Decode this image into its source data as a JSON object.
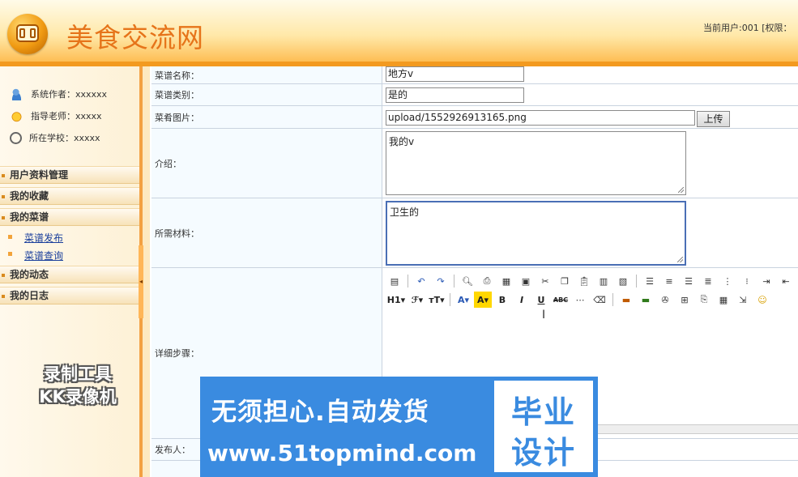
{
  "header": {
    "site_title": "美食交流网",
    "user_info": "当前用户:001 [权限："
  },
  "sidebar": {
    "info": [
      {
        "label": "系统作者：xxxxxx",
        "icon": "user-icon"
      },
      {
        "label": "指导老师：xxxxx",
        "icon": "teacher-icon"
      },
      {
        "label": "所在学校：xxxxx",
        "icon": "school-icon"
      }
    ],
    "menus": {
      "profile": "用户资料管理",
      "favorites": "我的收藏",
      "recipes": "我的菜谱",
      "recipe_publish": "菜谱发布",
      "recipe_query": "菜谱查询",
      "activity": "我的动态",
      "diary": "我的日志"
    },
    "watermark_line1": "录制工具",
    "watermark_line2": "KK录像机"
  },
  "form": {
    "name_label": "菜谱名称：",
    "name_value": "地方v",
    "category_label": "菜谱类别：",
    "category_value": "是的",
    "image_label": "菜肴图片：",
    "image_value": "upload/1552926913165.png",
    "upload_button": "上传",
    "intro_label": "介绍：",
    "intro_value": "我的v",
    "materials_label": "所需材料：",
    "materials_value": "卫生的",
    "steps_label": "详细步骤：",
    "publisher_label": "发布人："
  },
  "editor": {
    "heading_label": "H1",
    "font_family_label": "ℱ",
    "font_size_label": "тT",
    "font_color_label": "A",
    "bg_color_label": "A",
    "bold_label": "B",
    "italic_label": "I",
    "underline_label": "U",
    "strike_label": "ABC",
    "resize_glyph": "⇕"
  },
  "banner": {
    "line1": "无须担心.自动发货",
    "line2": "www.51topmind.com",
    "box_line1": "毕业",
    "box_line2": "设计"
  }
}
